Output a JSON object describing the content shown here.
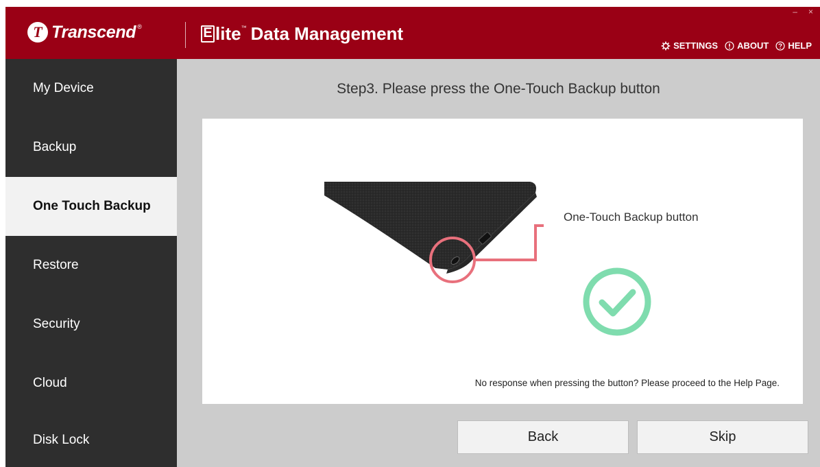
{
  "header": {
    "brand": "Transcend",
    "brand_reg": "®",
    "product_logo": "lite",
    "product_logo_letter": "E",
    "product_tm": "™",
    "product_name": "Data Management",
    "links": [
      {
        "label": "SETTINGS",
        "icon": "gear-icon"
      },
      {
        "label": "ABOUT",
        "icon": "info-circle-icon"
      },
      {
        "label": "HELP",
        "icon": "help-circle-icon"
      }
    ],
    "window_controls": {
      "minimize": "–",
      "close": "×"
    }
  },
  "sidebar": {
    "items": [
      {
        "label": "My Device",
        "active": false
      },
      {
        "label": "Backup",
        "active": false
      },
      {
        "label": "One Touch Backup",
        "active": true
      },
      {
        "label": "Restore",
        "active": false
      },
      {
        "label": "Security",
        "active": false
      },
      {
        "label": "Cloud",
        "active": false
      },
      {
        "label": "Disk Lock",
        "active": false
      }
    ]
  },
  "main": {
    "step_title": "Step3. Please press the One-Touch Backup button",
    "callout_label": "One-Touch Backup button",
    "help_note": "No response when pressing the button? Please proceed to the Help Page.",
    "status_icon": "check-circle-icon",
    "buttons": {
      "back": "Back",
      "skip": "Skip"
    }
  },
  "colors": {
    "header_bg": "#9a0015",
    "sidebar_bg": "#2e2e2e",
    "sidebar_active_bg": "#f2f2f2",
    "main_bg": "#cccccc",
    "check_green": "#7fdcae",
    "callout_red": "#e8707c"
  }
}
